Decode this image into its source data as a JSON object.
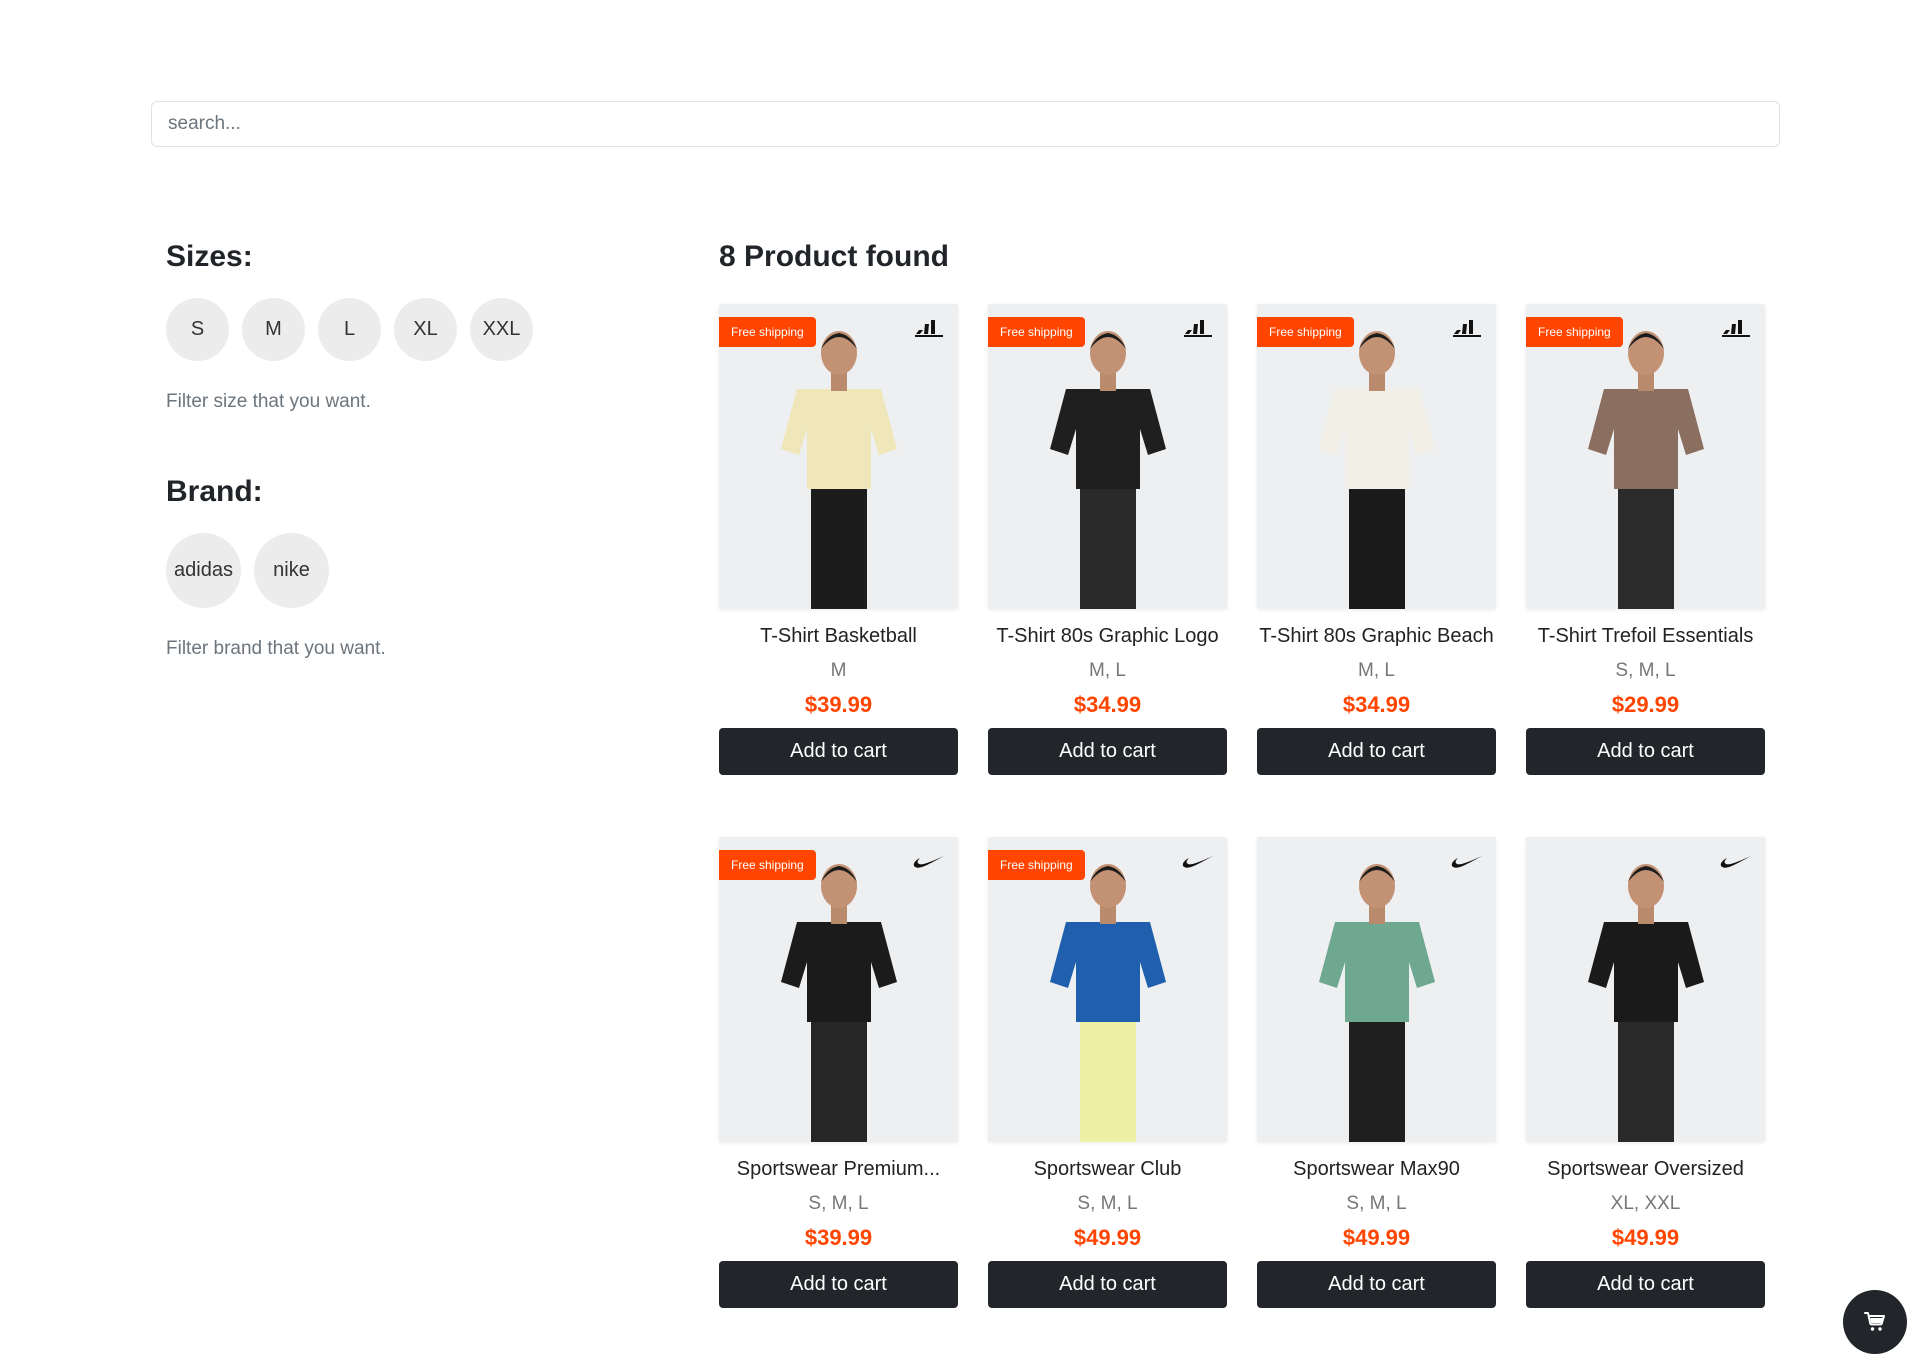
{
  "search": {
    "placeholder": "search..."
  },
  "filters": {
    "sizes": {
      "title": "Sizes:",
      "options": [
        "S",
        "M",
        "L",
        "XL",
        "XXL"
      ],
      "note": "Filter size that you want."
    },
    "brand": {
      "title": "Brand:",
      "options": [
        "adidas",
        "nike"
      ],
      "note": "Filter brand that you want."
    }
  },
  "results": {
    "title": "8 Product found"
  },
  "products": [
    {
      "name": "T-Shirt Basketball",
      "sizes": "M",
      "price": "$39.99",
      "free_shipping": true,
      "free_shipping_label": "Free shipping",
      "brand": "adidas",
      "shirt_color": "#efe7b9",
      "pants_color": "#1c1c1c",
      "add_label": "Add to cart"
    },
    {
      "name": "T-Shirt 80s Graphic Logo",
      "sizes": "M, L",
      "price": "$34.99",
      "free_shipping": true,
      "free_shipping_label": "Free shipping",
      "brand": "adidas",
      "shirt_color": "#1f1f1f",
      "pants_color": "#2a2a2a",
      "add_label": "Add to cart"
    },
    {
      "name": "T-Shirt 80s Graphic Beach",
      "sizes": "M, L",
      "price": "$34.99",
      "free_shipping": true,
      "free_shipping_label": "Free shipping",
      "brand": "adidas",
      "shirt_color": "#f2f0e6",
      "pants_color": "#1a1a1a",
      "add_label": "Add to cart"
    },
    {
      "name": "T-Shirt Trefoil Essentials",
      "sizes": "S, M, L",
      "price": "$29.99",
      "free_shipping": true,
      "free_shipping_label": "Free shipping",
      "brand": "adidas",
      "shirt_color": "#8a6e5f",
      "pants_color": "#2b2b2b",
      "add_label": "Add to cart"
    },
    {
      "name": "Sportswear Premium...",
      "sizes": "S, M, L",
      "price": "$39.99",
      "free_shipping": true,
      "free_shipping_label": "Free shipping",
      "brand": "nike",
      "shirt_color": "#1b1b1b",
      "pants_color": "#262626",
      "add_label": "Add to cart"
    },
    {
      "name": "Sportswear Club",
      "sizes": "S, M, L",
      "price": "$49.99",
      "free_shipping": true,
      "free_shipping_label": "Free shipping",
      "brand": "nike",
      "shirt_color": "#1f5fae",
      "pants_color": "#eef0a6",
      "add_label": "Add to cart"
    },
    {
      "name": "Sportswear Max90",
      "sizes": "S, M, L",
      "price": "$49.99",
      "free_shipping": false,
      "free_shipping_label": "",
      "brand": "nike",
      "shirt_color": "#6ea891",
      "pants_color": "#1f1f1f",
      "add_label": "Add to cart"
    },
    {
      "name": "Sportswear Oversized",
      "sizes": "XL, XXL",
      "price": "$49.99",
      "free_shipping": false,
      "free_shipping_label": "",
      "brand": "nike",
      "shirt_color": "#1a1a1a",
      "pants_color": "#2a2a2a",
      "add_label": "Add to cart"
    }
  ],
  "icons": {
    "cart": "shopping-cart-icon"
  },
  "colors": {
    "accent": "#ff4500",
    "button": "#22262b",
    "chip": "#ececec"
  }
}
